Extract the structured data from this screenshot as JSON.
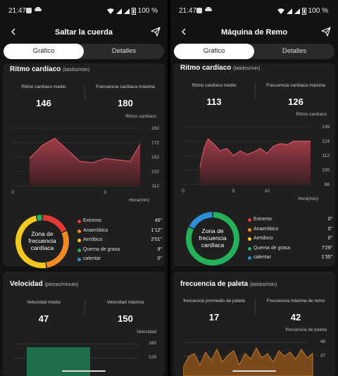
{
  "left": {
    "status": {
      "time": "21:47",
      "battery": "100 %"
    },
    "header": {
      "title": "Saltar la cuerda"
    },
    "tabs": [
      {
        "label": "Gráfico"
      },
      {
        "label": "Detalles"
      }
    ],
    "heart_card": {
      "title": "Ritmo cardíaco",
      "unit": "(latidos/min)",
      "avg_label": "Ritmo cardíaco medio",
      "avg_value": "146",
      "max_label": "Frecuencia cardíaca máxima",
      "max_value": "180",
      "chart_ylabel": "Ritmo cardíaco",
      "chart_xlabel": "Hora(min)",
      "y_ticks": [
        "192",
        "172",
        "152",
        "132",
        "112"
      ],
      "x_ticks": [
        "0",
        "3"
      ],
      "zone_center": [
        "Zona de",
        "frecuencia",
        "cardíaca"
      ],
      "zones": [
        {
          "name": "Extremo",
          "time": "45\"",
          "color": "#e53935"
        },
        {
          "name": "Anaeróbico",
          "time": "1'12\"",
          "color": "#f08a24"
        },
        {
          "name": "Aeróbico",
          "time": "2'01\"",
          "color": "#f2c81e"
        },
        {
          "name": "Quema de grasa",
          "time": "9\"",
          "color": "#25b05a"
        },
        {
          "name": "calentar",
          "time": "0\"",
          "color": "#2a8fd8"
        }
      ]
    },
    "speed_card": {
      "title": "Velocidad",
      "unit": "(piezas/minuto)",
      "avg_label": "Velocidad media",
      "avg_value": "47",
      "max_label": "Velocidad máxima",
      "max_value": "150",
      "chart_ylabel": "Velocidad",
      "y_ticks": [
        "160",
        "129"
      ]
    }
  },
  "right": {
    "status": {
      "time": "21:47",
      "battery": "100 %"
    },
    "header": {
      "title": "Máquina de Remo"
    },
    "tabs": [
      {
        "label": "Gráfico"
      },
      {
        "label": "Detalles"
      }
    ],
    "heart_card": {
      "title": "Ritmo cardíaco",
      "unit": "(latidos/min)",
      "avg_label": "Ritmo cardíaco medio",
      "avg_value": "113",
      "max_label": "Frecuencia cardíaca máxima",
      "max_value": "126",
      "chart_ylabel": "Ritmo cardíaco",
      "chart_xlabel": "Hora(min)",
      "y_ticks": [
        "136",
        "124",
        "112",
        "100",
        "88"
      ],
      "x_ticks": [
        "0",
        "5",
        "10"
      ],
      "zone_center": [
        "Zona de",
        "frecuencia",
        "cardíaca"
      ],
      "zones": [
        {
          "name": "Extremo",
          "time": "0\"",
          "color": "#e53935"
        },
        {
          "name": "Anaeróbico",
          "time": "0\"",
          "color": "#f08a24"
        },
        {
          "name": "Aeróbico",
          "time": "0\"",
          "color": "#f2c81e"
        },
        {
          "name": "Quema de grasa",
          "time": "7'29\"",
          "color": "#25b05a"
        },
        {
          "name": "calentar",
          "time": "1'35\"",
          "color": "#2a8fd8"
        }
      ]
    },
    "stroke_card": {
      "title": "frecuencia de paleta",
      "unit": "(latidos/min)",
      "avg_label": "frecuencia promedio de paleta",
      "avg_value": "17",
      "max_label": "Frecuencia máxima de remo",
      "max_value": "42",
      "chart_ylabel": "frecuencia de paleta",
      "y_ticks": [
        "48",
        "37"
      ]
    }
  },
  "chart_data": [
    {
      "type": "area",
      "ylabel": "Ritmo cardíaco",
      "xlabel": "Hora(min)",
      "ylim": [
        112,
        192
      ],
      "x": [
        0,
        0.5,
        1,
        1.5,
        2,
        2.5,
        3,
        3.5,
        4,
        4.4
      ],
      "series": [
        {
          "values": [
            150,
            168,
            178,
            162,
            146,
            144,
            150,
            148,
            146,
            170
          ]
        }
      ]
    },
    {
      "type": "pie",
      "categories": [
        "Extremo",
        "Anaeróbico",
        "Aeróbico",
        "Quema de grasa",
        "calentar"
      ],
      "values": [
        45,
        72,
        121,
        9,
        0
      ]
    },
    {
      "type": "area",
      "ylabel": "Ritmo cardíaco",
      "xlabel": "Hora(min)",
      "ylim": [
        88,
        136
      ],
      "x": [
        0,
        0.6,
        1.2,
        2,
        3,
        4,
        5,
        6,
        7,
        8,
        9,
        10,
        11,
        12,
        13,
        14,
        15,
        16.5
      ],
      "series": [
        {
          "values": [
            102,
            118,
            126,
            122,
            116,
            118,
            112,
            116,
            113,
            115,
            118,
            114,
            120,
            122,
            121,
            124,
            124,
            124
          ]
        }
      ]
    },
    {
      "type": "pie",
      "categories": [
        "Extremo",
        "Anaeróbico",
        "Aeróbico",
        "Quema de grasa",
        "calentar"
      ],
      "values": [
        0,
        0,
        0,
        449,
        95
      ]
    }
  ]
}
